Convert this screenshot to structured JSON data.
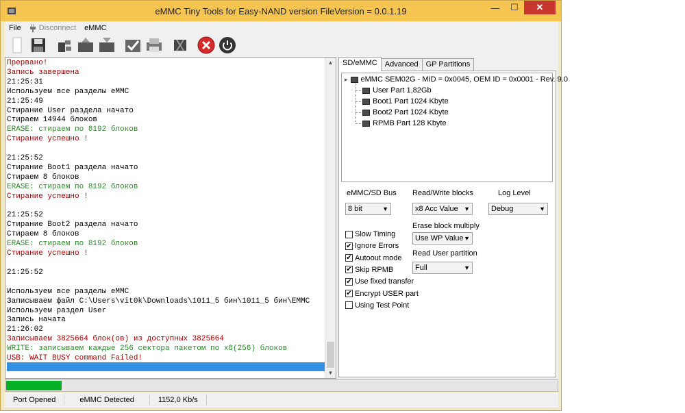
{
  "window": {
    "title": "eMMC Tiny Tools for Easy-NAND version FileVersion = 0.0.1.19",
    "minimize": "—",
    "maximize": "☐",
    "close": "✕"
  },
  "menu": {
    "file": "File",
    "disconnect": "Disconnect",
    "emmc": "eMMC"
  },
  "log": {
    "lines": [
      {
        "t": "Прервано!",
        "c": "red"
      },
      {
        "t": "Запись завершена",
        "c": "red"
      },
      {
        "t": "21:25:31",
        "c": "black"
      },
      {
        "t": "Используем все разделы eMMC",
        "c": "black"
      },
      {
        "t": "21:25:49",
        "c": "black"
      },
      {
        "t": "Стирание User раздела начато",
        "c": "black"
      },
      {
        "t": "Стираем 14944 блоков",
        "c": "black"
      },
      {
        "t": "ERASE: стираем по 8192 блоков",
        "c": "green"
      },
      {
        "t": "Стирание успешно !",
        "c": "red"
      },
      {
        "t": "",
        "c": "black"
      },
      {
        "t": "21:25:52",
        "c": "black"
      },
      {
        "t": "Стирание Boot1 раздела начато",
        "c": "black"
      },
      {
        "t": "Стираем 8 блоков",
        "c": "black"
      },
      {
        "t": "ERASE: стираем по 8192 блоков",
        "c": "green"
      },
      {
        "t": "Стирание успешно !",
        "c": "red"
      },
      {
        "t": "",
        "c": "black"
      },
      {
        "t": "21:25:52",
        "c": "black"
      },
      {
        "t": "Стирание Boot2 раздела начато",
        "c": "black"
      },
      {
        "t": "Стираем 8 блоков",
        "c": "black"
      },
      {
        "t": "ERASE: стираем по 8192 блоков",
        "c": "green"
      },
      {
        "t": "Стирание успешно !",
        "c": "red"
      },
      {
        "t": "",
        "c": "black"
      },
      {
        "t": "21:25:52",
        "c": "black"
      },
      {
        "t": "",
        "c": "black"
      },
      {
        "t": "Используем все разделы eMMC",
        "c": "black"
      },
      {
        "t": "Записываем файл C:\\Users\\vit0k\\Downloads\\1011_5 бин\\1011_5 бин\\EMMC",
        "c": "black"
      },
      {
        "t": "Используем раздел User",
        "c": "black"
      },
      {
        "t": "Запись начата",
        "c": "black"
      },
      {
        "t": "21:26:02",
        "c": "black"
      },
      {
        "t": "Записываем 3825664 блок(ов) из доступных 3825664",
        "c": "red"
      },
      {
        "t": "WRITE: записываем каждые 256 сектора пакетом по x8(256) блоков",
        "c": "green"
      },
      {
        "t": "USB: WAIT BUSY command Failed!",
        "c": "red"
      }
    ]
  },
  "tabs": [
    "SD/eMMC",
    "Advanced",
    "GP Partitions"
  ],
  "tree": {
    "root": "eMMC SEM02G - MID = 0x0045, OEM ID = 0x0001 - Rev. 9.0",
    "children": [
      "User Part 1,82Gb",
      "Boot1 Part 1024 Kbyte",
      "Boot2 Part 1024 Kbyte",
      "RPMB Part 128 Kbyte"
    ]
  },
  "settings": {
    "bus_label": "eMMC/SD Bus",
    "bus_value": "8 bit",
    "rw_label": "Read/Write  blocks",
    "rw_value": "x8 Acc Value",
    "log_label": "Log Level",
    "log_value": "Debug",
    "erase_label": "Erase block multiply",
    "erase_value": "Use WP Value",
    "readuser_label": "Read User partition",
    "readuser_value": "Full"
  },
  "checkboxes": [
    {
      "label": "Slow Timing",
      "checked": false
    },
    {
      "label": "Ignore Errors",
      "checked": true
    },
    {
      "label": "Autoout mode",
      "checked": true
    },
    {
      "label": "Skip RPMB",
      "checked": true
    },
    {
      "label": "Use fixed transfer",
      "checked": true
    },
    {
      "label": "Encrypt USER part",
      "checked": true
    },
    {
      "label": "Using Test Point",
      "checked": false
    }
  ],
  "progress": {
    "fraction": 0.1
  },
  "status": {
    "port": "Port Opened",
    "emmc": "eMMC Detected",
    "speed": "1152,0 Kb/s"
  },
  "colors": {
    "accent": "#f5c451",
    "progress": "#06b025",
    "highlight": "#3391e3"
  }
}
